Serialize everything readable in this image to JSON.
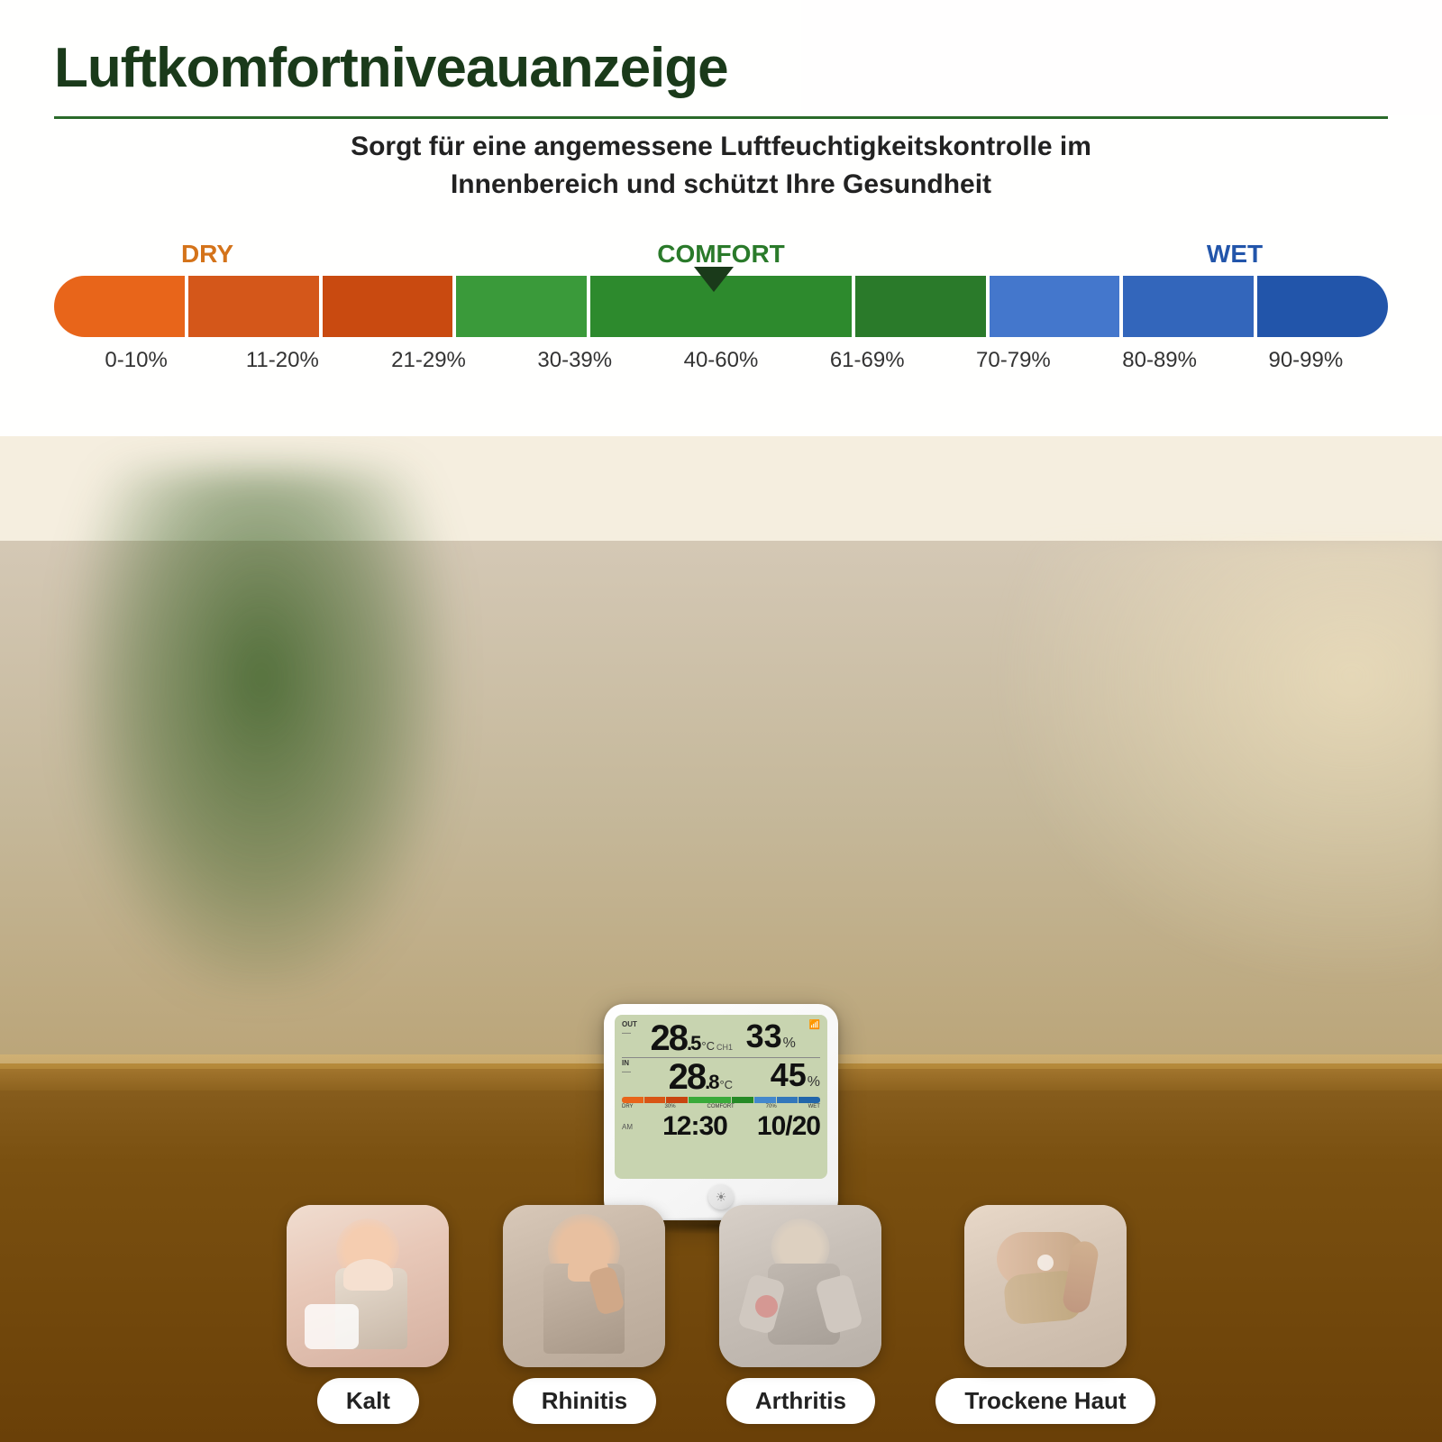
{
  "header": {
    "main_title": "Luftkomfortniveauanzeige",
    "subtitle_line1": "Sorgt für eine angemessene Luftfeuchtigkeitskontrolle im",
    "subtitle_line2": "Innenbereich und schützt Ihre Gesundheit"
  },
  "humidity_chart": {
    "label_dry": "DRY",
    "label_comfort": "COMFORT",
    "label_wet": "WET",
    "segments": [
      {
        "range": "0-10%",
        "color": "#e8651a"
      },
      {
        "range": "11-20%",
        "color": "#d85a15"
      },
      {
        "range": "21-29%",
        "color": "#c84d10"
      },
      {
        "range": "30-39%",
        "color": "#3aaa3a"
      },
      {
        "range": "40-60%",
        "color": "#2d9a2d"
      },
      {
        "range": "61-69%",
        "color": "#268a26"
      },
      {
        "range": "70-79%",
        "color": "#4488cc"
      },
      {
        "range": "80-89%",
        "color": "#3377bb"
      },
      {
        "range": "90-99%",
        "color": "#2266aa"
      }
    ],
    "percentages": [
      "0-10%",
      "11-20%",
      "21-29%",
      "30-39%",
      "40-60%",
      "61-69%",
      "70-79%",
      "80-89%",
      "90-99%"
    ]
  },
  "device": {
    "out_label": "OUT",
    "in_label": "IN",
    "ch1_label": "CH1",
    "out_temp": "28.5",
    "out_humidity": "33",
    "in_temp": "28.8",
    "in_humidity": "45",
    "time": "12:30",
    "date": "10/20",
    "dry_label": "DRY",
    "comfort_label": "COMFORT",
    "wet_label": "WET",
    "bar_30": "30%",
    "bar_70": "70%"
  },
  "icon_cards": [
    {
      "id": "kalt",
      "label": "Kalt",
      "emoji": "🤧"
    },
    {
      "id": "rhinitis",
      "label": "Rhinitis",
      "emoji": "🤧"
    },
    {
      "id": "arthritis",
      "label": "Arthritis",
      "emoji": "💪"
    },
    {
      "id": "trockene-haut",
      "label": "Trockene Haut",
      "emoji": "🖐"
    }
  ],
  "colors": {
    "title_green": "#1a3a1a",
    "accent_green": "#2a6a2a",
    "dry_orange": "#d4731a",
    "comfort_green": "#2a7a2a",
    "wet_blue": "#2255aa"
  }
}
